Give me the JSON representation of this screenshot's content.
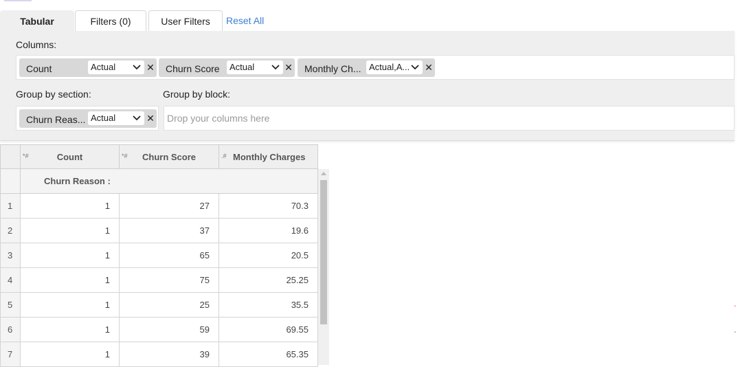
{
  "tabs": [
    {
      "label": "Tabular"
    },
    {
      "label": "Filters (0)"
    },
    {
      "label": "User Filters"
    }
  ],
  "reset_label": "Reset All",
  "columns_label": "Columns:",
  "column_chips": [
    {
      "name": "Count",
      "agg": "Actual"
    },
    {
      "name": "Churn Score",
      "agg": "Actual"
    },
    {
      "name": "Monthly Ch...",
      "agg": "Actual,A..."
    }
  ],
  "group_section_label": "Group by section:",
  "group_block_label": "Group by block:",
  "section_chip": {
    "name": "Churn Reas...",
    "agg": "Actual"
  },
  "block_placeholder": "Drop your columns here",
  "grid": {
    "headers": [
      "Count",
      "Churn Score",
      "Monthly Charges"
    ],
    "header_icons": [
      "*#",
      "*#",
      ".#"
    ],
    "section_label": "Churn Reason :",
    "rows": [
      {
        "n": "1",
        "count": "1",
        "score": "27",
        "charges": "70.3"
      },
      {
        "n": "2",
        "count": "1",
        "score": "37",
        "charges": "19.6"
      },
      {
        "n": "3",
        "count": "1",
        "score": "65",
        "charges": "20.5"
      },
      {
        "n": "4",
        "count": "1",
        "score": "75",
        "charges": "25.25"
      },
      {
        "n": "5",
        "count": "1",
        "score": "25",
        "charges": "35.5"
      },
      {
        "n": "6",
        "count": "1",
        "score": "59",
        "charges": "69.55"
      },
      {
        "n": "7",
        "count": "1",
        "score": "39",
        "charges": "65.35"
      }
    ]
  },
  "colors": {
    "accent_link": "#3a7fd5",
    "panel_bg": "#efefef",
    "chip_bg": "#d8d8d8"
  }
}
